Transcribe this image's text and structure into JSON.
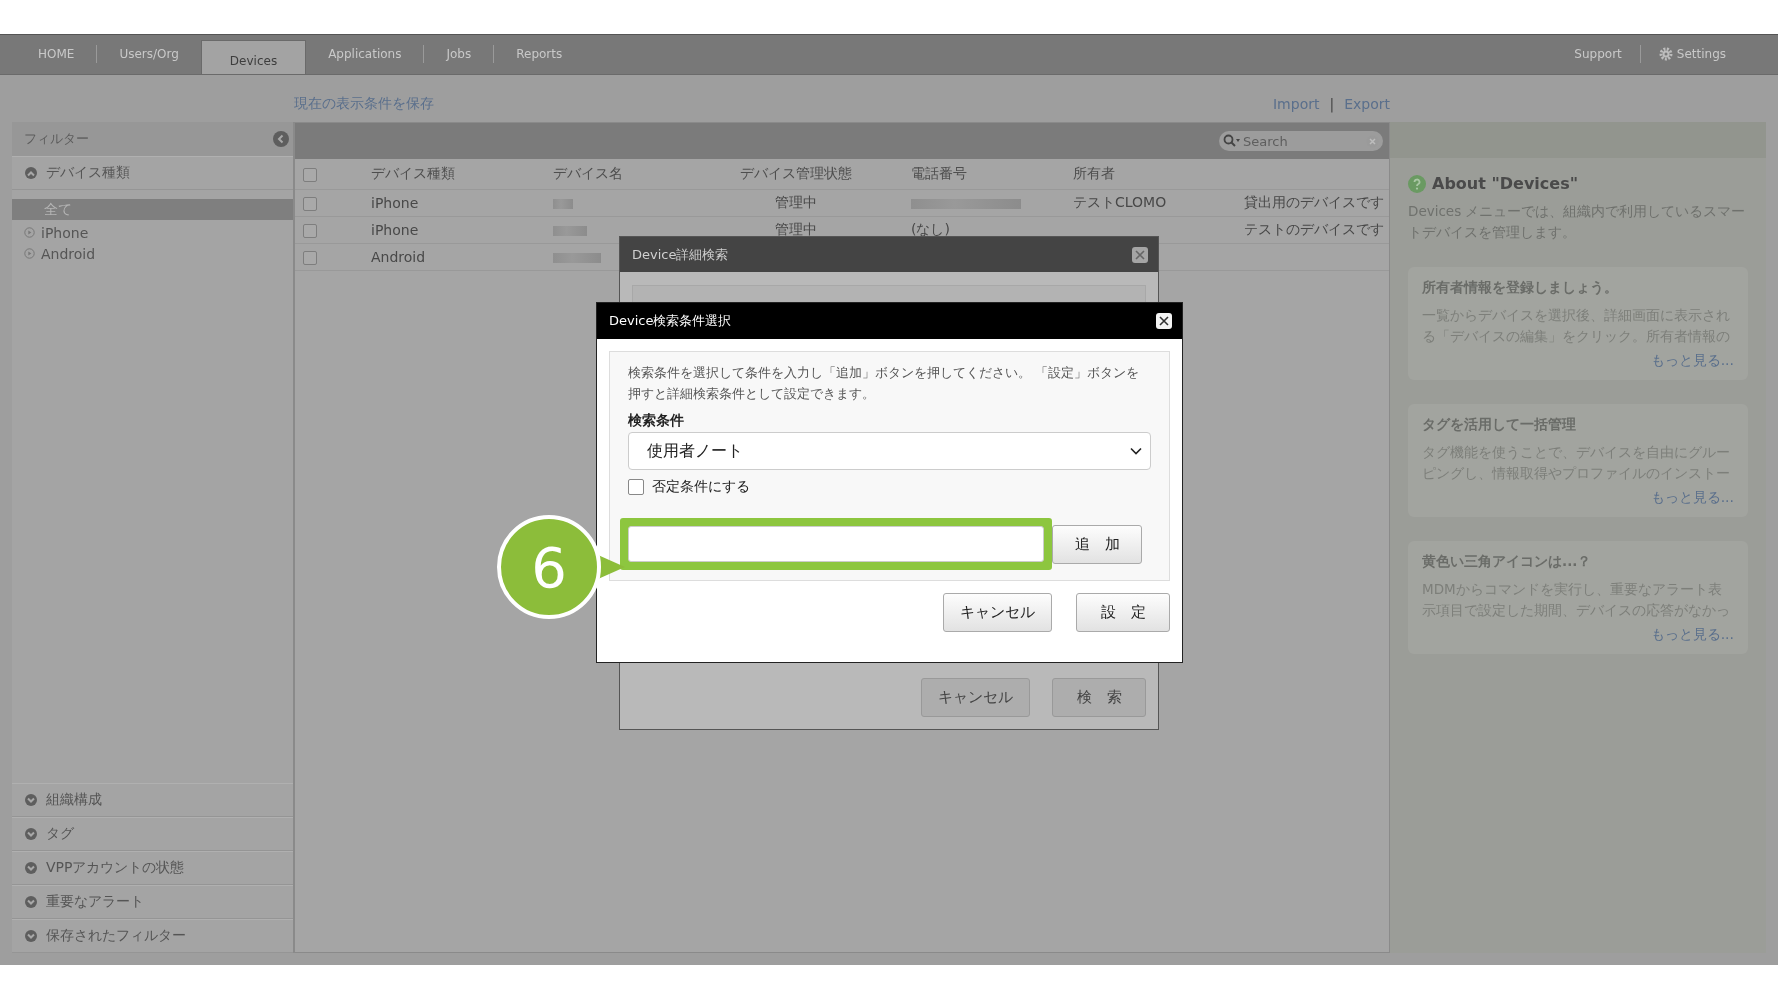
{
  "nav": {
    "tabs": [
      {
        "label": "HOME",
        "selected": false
      },
      {
        "label": "Users/Org",
        "selected": false
      },
      {
        "label": "Devices",
        "selected": true
      },
      {
        "label": "Applications",
        "selected": false
      },
      {
        "label": "Jobs",
        "selected": false
      },
      {
        "label": "Reports",
        "selected": false
      }
    ],
    "right": [
      {
        "label": "Support",
        "kind": "link"
      },
      {
        "label": "Settings",
        "kind": "settings"
      }
    ]
  },
  "save_link": "現在の表示条件を保存",
  "io_links": {
    "import": "Import",
    "separator": "|",
    "export": "Export"
  },
  "sidebar": {
    "title": "フィルター",
    "sections": [
      {
        "label": "デバイス種類",
        "expanded": true,
        "items": [
          {
            "label": "全て",
            "selected": true
          },
          {
            "label": "iPhone",
            "selected": false
          },
          {
            "label": "Android",
            "selected": false
          }
        ]
      },
      {
        "label": "組織構成",
        "expanded": false
      },
      {
        "label": "タグ",
        "expanded": false
      },
      {
        "label": "VPPアカウントの状態",
        "expanded": false
      },
      {
        "label": "重要なアラート",
        "expanded": false
      },
      {
        "label": "保存されたフィルター",
        "expanded": false
      }
    ]
  },
  "table": {
    "search_placeholder": "Search",
    "select_all_checked": false,
    "columns": [
      "デバイス種類",
      "デバイス名",
      "デバイス管理状態",
      "電話番号",
      "所有者"
    ],
    "rows": [
      {
        "checked": false,
        "device_type": "iPhone",
        "name_redacted": true,
        "status": "管理中",
        "phone_redacted": true,
        "owner": "テストCLOMO",
        "note": "貸出用のデバイスです"
      },
      {
        "checked": false,
        "device_type": "iPhone",
        "name_redacted": true,
        "status": "管理中",
        "phone": "(なし)",
        "note": "テストのデバイスです"
      },
      {
        "checked": false,
        "device_type": "Android",
        "name_redacted": true
      }
    ]
  },
  "help": {
    "title": "About \"Devices\"",
    "intro": "Devices メニューでは、組織内で利用しているスマートデバイスを管理します。",
    "cards": [
      {
        "title": "所有者情報を登録しましょう。",
        "body": "一覧からデバイスを選択後、詳細画面に表示される「デバイスの編集」をクリック。所有者情報の",
        "more": "もっと見る..."
      },
      {
        "title": "タグを活用して一括管理",
        "body": "タグ機能を使うことで、デバイスを自由にグルーピングし、情報取得やプロファイルのインストー",
        "more": "もっと見る..."
      },
      {
        "title": "黄色い三角アイコンは...？",
        "body": "MDMからコマンドを実行し、重要なアラート表示項目で設定した期間、デバイスの応答がなかっ",
        "more": "もっと見る..."
      }
    ]
  },
  "detail_dialog": {
    "title": "Device詳細検索",
    "buttons": [
      "キャンセル",
      "検　索"
    ]
  },
  "condition_dialog": {
    "title": "Device検索条件選択",
    "description": "検索条件を選択して条件を入力し「追加」ボタンを押してください。 「設定」ボタンを押すと詳細検索条件として設定できます。",
    "field_label": "検索条件",
    "select_value": "使用者ノート",
    "negate": {
      "label": "否定条件にする",
      "checked": false
    },
    "add_button": "追　加",
    "buttons": [
      "キャンセル",
      "設　定"
    ]
  },
  "callout": {
    "number": "6"
  }
}
